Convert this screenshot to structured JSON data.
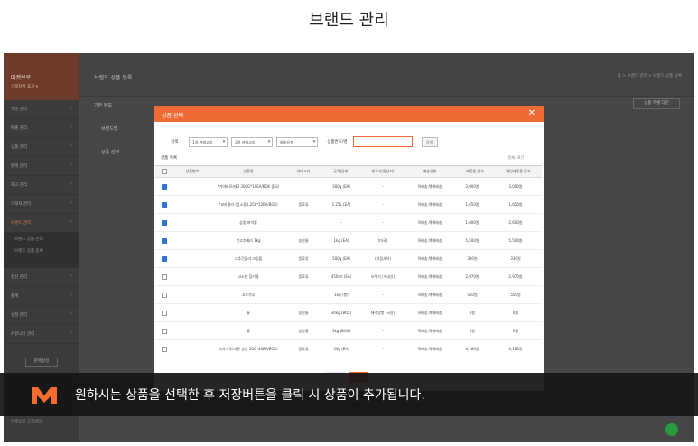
{
  "page_title": "브랜드 관리",
  "sidebar": {
    "brand_title": "마켓보로",
    "brand_sub": "거래처명 표기 ▾",
    "items": [
      "주문 관리",
      "매출 관리",
      "상품 관리",
      "판매 관리",
      "재고 관리",
      "거래처 관리",
      "브랜드 관리"
    ],
    "sub_items": [
      "브랜드 상품 관리",
      "브랜드 상품 등록"
    ],
    "items_after": [
      "정산 관리",
      "통계",
      "설정 관리",
      "커뮤니티 관리"
    ],
    "button": "판매설정",
    "footer": "마켓보로 고객센터"
  },
  "main": {
    "title": "브랜드 상품 등록",
    "breadcrumb": "홈  >  브랜드 관리  >  브랜드 상품 등록",
    "section_label": "기본 정보",
    "field_brand": "브랜드명",
    "field_product": "상품 선택",
    "right_button": "상품 엑셀 다운"
  },
  "modal": {
    "title": "상품 선택",
    "close": "✕",
    "filter": {
      "label": "검색",
      "select1": "1차 카테고리",
      "select2": "2차 카테고리",
      "select3": "배송유형",
      "product_label": "상품번호/명",
      "search_button": "검색"
    },
    "list_title": "상품 목록",
    "count": "전체 40건",
    "columns": [
      "",
      "상품번호",
      "상품명",
      "카테고리",
      "규격(단위)",
      "제조사(원산지)",
      "배송유형",
      "매출용 단가",
      "매입매출용 단가"
    ],
    "rows": [
      {
        "checked": true,
        "code": "",
        "name": "*가야바로(제3 300G*10EA/BOX 중국)",
        "cat": "",
        "spec": "300g (EA)",
        "maker": "-",
        "ship": "직배송,택배배송",
        "p1": "3,000원",
        "p2": "3,000원"
      },
      {
        "checked": true,
        "code": "",
        "name": "*코카콜라 (업소용1.25L*12EA/BOX)",
        "cat": "음료류",
        "spec": "1.25L (EA)",
        "maker": "-",
        "ship": "직배송,택배배송",
        "p1": "1,650원",
        "p2": "1,650원"
      },
      {
        "checked": true,
        "code": "",
        "name": "삼중 파이롤",
        "cat": "",
        "spec": "-",
        "maker": "-",
        "ship": "직배송,택배배송",
        "p1": "1,600원",
        "p2": "2,600원"
      },
      {
        "checked": true,
        "code": "",
        "name": "건고추메리 1kg",
        "cat": "농산물",
        "spec": "1kg (EA)",
        "maker": "(미국)",
        "ship": "직배송,택배배송",
        "p1": "5,500원",
        "p2": "5,500원"
      },
      {
        "checked": true,
        "code": "",
        "name": "고추건플라 크림볼",
        "cat": "음료류",
        "spec": "500g (EA)",
        "maker": "(미림사이)",
        "ship": "직배송,택배배송",
        "p1": "330원",
        "p2": "330원"
      },
      {
        "checked": false,
        "code": "",
        "name": "고소한 참기름",
        "cat": "음료류",
        "spec": "450ml (EA)",
        "maker": "오뚜기 (우네산)",
        "ship": "직배송,택배배송",
        "p1": "2,970원",
        "p2": "2,970원"
      },
      {
        "checked": false,
        "code": "",
        "name": "고추가루",
        "cat": "",
        "spec": "1kg (봉)",
        "maker": "-",
        "ship": "직배송,택배배송",
        "p1": "550원",
        "p2": "550원"
      },
      {
        "checked": false,
        "code": "",
        "name": "꿀",
        "cat": "농산물",
        "spec": "30kg (BOX)",
        "maker": "제주양봉 (국산)",
        "ship": "직배송,택배배송",
        "p1": "0원",
        "p2": "0원"
      },
      {
        "checked": false,
        "code": "",
        "name": "꿀",
        "cat": "농산물",
        "spec": "1kg (BOX)",
        "maker": "-",
        "ship": "직배송,택배배송",
        "p1": "0원",
        "p2": "0원"
      },
      {
        "checked": false,
        "code": "",
        "name": "녹차가루(지관 상입 50G*40EA/BOX)",
        "cat": "음료류",
        "spec": "50g (EA)",
        "maker": "-",
        "ship": "직배송,택배배송",
        "p1": "4,180원",
        "p2": "4,180원"
      }
    ],
    "more": "...",
    "cancel": "취소",
    "save": "저장"
  },
  "caption": {
    "text": "원하시는 상품을 선택한 후 저장버튼을 클릭 시 상품이 추가됩니다."
  }
}
